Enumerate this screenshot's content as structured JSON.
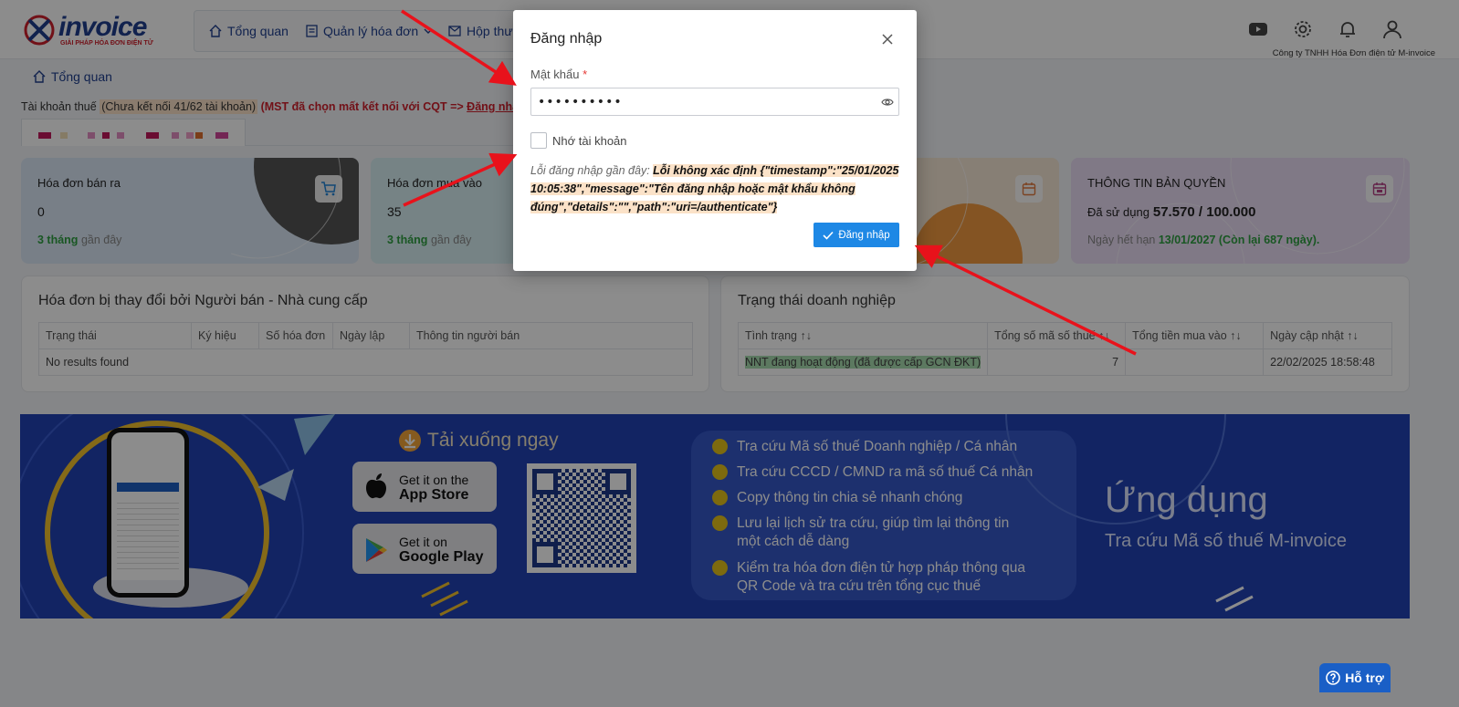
{
  "app": {
    "logo_text": "invoice",
    "logo_tagline": "GIẢI PHÁP HÓA ĐƠN ĐIỆN TỬ",
    "company": "Công ty TNHH Hóa Đơn điện tử M-invoice"
  },
  "nav": {
    "items": [
      {
        "label": "Tổng quan",
        "icon": "home-icon"
      },
      {
        "label": "Quản lý hóa đơn",
        "icon": "document-icon"
      },
      {
        "label": "Hộp thư",
        "icon": "mail-icon"
      }
    ]
  },
  "breadcrumb": {
    "label": "Tổng quan"
  },
  "tax_account": {
    "label": "Tài khoản thuế",
    "status": "(Chưa kết nối 41/62 tài khoản)",
    "warning": "(MST đã chọn mất kết nối với CQT =>",
    "link": "Đăng nhập"
  },
  "cards": [
    {
      "title": "Hóa đơn bán ra",
      "value": "0",
      "period_bold": "3 tháng",
      "period": "gần đây",
      "color": "#dbe8f6"
    },
    {
      "title": "Hóa đơn mua vào",
      "value": "35",
      "period_bold": "3 tháng",
      "period": "gần đây",
      "color": "#d8eef2"
    },
    {
      "title": "",
      "value": "",
      "color": "#f4a04a"
    },
    {
      "title": "THÔNG TIN BẢN QUYỀN",
      "value_label": "Đã sử dụng",
      "value": "57.570 / 100.000",
      "expiry_label": "Ngày hết hạn",
      "expiry_date": "13/01/2027",
      "expiry_note": "(Còn lại 687 ngày).",
      "color": "#e9dcf4"
    }
  ],
  "changed_invoices": {
    "title": "Hóa đơn bị thay đổi bởi Người bán - Nhà cung cấp",
    "columns": [
      "Trạng thái",
      "Ký hiệu",
      "Số hóa đơn",
      "Ngày lập",
      "Thông tin người bán"
    ],
    "empty": "No results found"
  },
  "business_status": {
    "title": "Trạng thái doanh nghiệp",
    "columns": [
      "Tình trạng",
      "Tổng số mã số thuế",
      "Tổng tiền mua vào",
      "Ngày cập nhật"
    ],
    "rows": [
      {
        "status": "NNT đang hoạt động (đã được cấp GCN ĐKT)",
        "count": "7",
        "amount": "",
        "updated": "22/02/2025 18:58:48"
      }
    ]
  },
  "banner": {
    "download": "Tải xuống ngay",
    "appstore_small": "Get it on the",
    "appstore_big": "App Store",
    "play_small": "Get it on",
    "play_big": "Google Play",
    "features": [
      "Tra cứu Mã số thuế Doanh nghiệp / Cá nhân",
      "Tra cứu CCCD / CMND ra mã số thuế Cá nhân",
      "Copy thông tin chia sẻ nhanh chóng",
      "Lưu lại lịch sử tra cứu, giúp tìm lại thông tin",
      "một cách dễ dàng",
      "Kiểm tra hóa đơn điện tử hợp pháp thông qua",
      "QR Code và tra cứu trên tổng cục thuế"
    ],
    "headline": "Ứng dụng",
    "subheadline": "Tra cứu Mã số thuế M-invoice"
  },
  "modal": {
    "title": "Đăng nhập",
    "password_label": "Mật khẩu",
    "required_mark": "*",
    "password_value": "••••••••••",
    "remember_label": "Nhớ tài khoản",
    "error_prefix": "Lỗi đăng nhập gần đây:",
    "error_message": "Lỗi không xác định {\"timestamp\":\"25/01/2025 10:05:38\",\"message\":\"Tên đăng nhập hoặc mật khẩu không đúng\",\"details\":\"\",\"path\":\"uri=/authenticate\"}",
    "submit_label": "Đăng nhập"
  },
  "help": {
    "label": "Hỗ trợ"
  }
}
